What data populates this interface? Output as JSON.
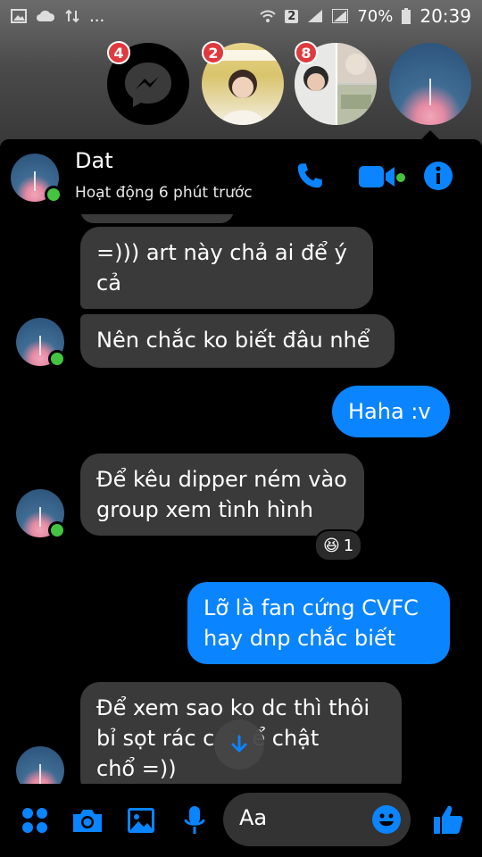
{
  "status_bar": {
    "sim": "2",
    "battery": "70%",
    "time": "20:39",
    "dots": "..."
  },
  "chat_heads": [
    {
      "name": "messenger-head",
      "badge": "4"
    },
    {
      "name": "contact-head-2",
      "badge": "2"
    },
    {
      "name": "contact-head-3",
      "badge": "8"
    },
    {
      "name": "contact-head-dat",
      "badge": ""
    }
  ],
  "header": {
    "contact_name": "Dat",
    "status": "Hoạt động 6 phút trước"
  },
  "messages": [
    {
      "from": "them",
      "lines": [
        "=))) art này chả ai để ý",
        "cả"
      ]
    },
    {
      "from": "them",
      "lines": [
        "Nên chắc ko biết đâu nhể"
      ]
    },
    {
      "from": "me",
      "lines": [
        "Haha :v"
      ]
    },
    {
      "from": "them",
      "lines": [
        "Để kêu dipper ném vào",
        "group xem tình hình"
      ],
      "reaction": {
        "emoji": "😆",
        "count": "1"
      }
    },
    {
      "from": "me",
      "lines": [
        "Lỡ là fan cứng CVFC",
        "hay dnp chắc biết"
      ]
    },
    {
      "from": "them",
      "lines": [
        "Để xem sao ko dc thì thôi",
        "bỉ sọt rác c",
        "chổ =))"
      ],
      "extra": "ể chật"
    }
  ],
  "composer": {
    "placeholder": "Aa"
  },
  "colors": {
    "accent": "#0a84ff",
    "incoming_bubble": "#3a3a3a",
    "online": "#44c440",
    "badge": "#e0393e"
  }
}
